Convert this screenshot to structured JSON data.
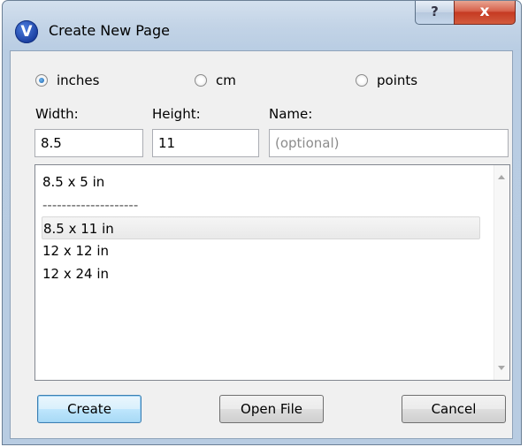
{
  "window": {
    "title": "Create New Page",
    "app_icon_letter": "V",
    "help_label": "?",
    "close_label": "x"
  },
  "units": {
    "options": [
      "inches",
      "cm",
      "points"
    ],
    "selected": "inches"
  },
  "fields": {
    "width_label": "Width:",
    "width_value": "8.5",
    "height_label": "Height:",
    "height_value": "11",
    "name_label": "Name:",
    "name_value": "",
    "name_placeholder": "(optional)"
  },
  "page_sizes": {
    "items": [
      "8.5 x 5 in",
      "--------------------",
      "8.5 x 11 in",
      "12 x 12 in",
      "12 x 24 in"
    ],
    "selected_index": 2
  },
  "buttons": {
    "create": "Create",
    "open_file": "Open File",
    "cancel": "Cancel"
  }
}
